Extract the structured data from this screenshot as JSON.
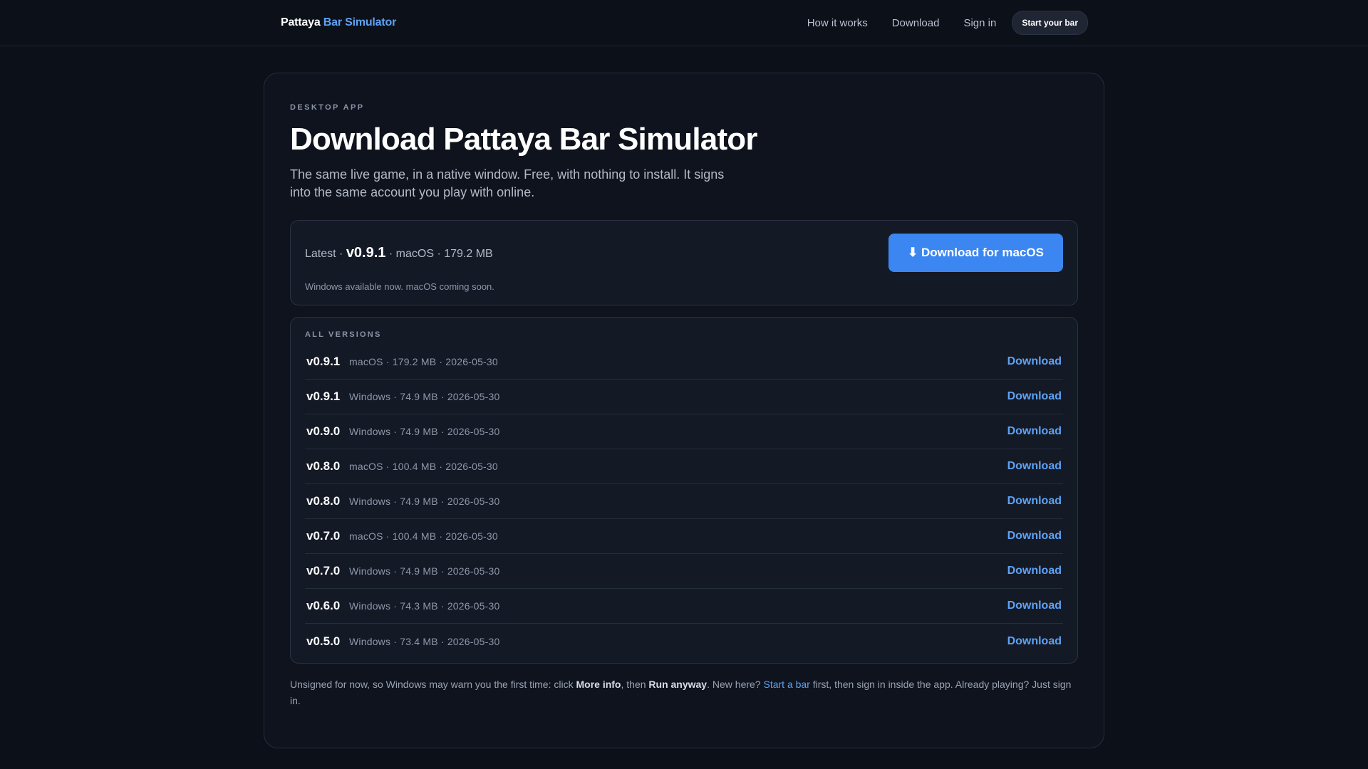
{
  "header": {
    "brand_part1": "Pattaya",
    "brand_part2": "Bar Simulator",
    "nav": {
      "how_it_works": "How it works",
      "download": "Download",
      "sign_in": "Sign in",
      "start_bar": "Start your bar"
    }
  },
  "hero": {
    "eyebrow": "DESKTOP APP",
    "title": "Download Pattaya Bar Simulator",
    "subtitle": "The same live game, in a native window. Free, with nothing to install. It signs into the same account you play with online."
  },
  "latest": {
    "prefix": "Latest ·",
    "version": "v0.9.1",
    "meta": "· macOS · 179.2 MB",
    "note": "Windows available now. macOS coming soon.",
    "button_label": "⬇ Download for macOS",
    "button_color": "#3b86f0"
  },
  "versions": {
    "heading": "ALL VERSIONS",
    "link_label": "Download",
    "rows": [
      {
        "version": "v0.9.1",
        "meta": "macOS · 179.2 MB · 2026-05-30"
      },
      {
        "version": "v0.9.1",
        "meta": "Windows · 74.9 MB · 2026-05-30"
      },
      {
        "version": "v0.9.0",
        "meta": "Windows · 74.9 MB · 2026-05-30"
      },
      {
        "version": "v0.8.0",
        "meta": "macOS · 100.4 MB · 2026-05-30"
      },
      {
        "version": "v0.8.0",
        "meta": "Windows · 74.9 MB · 2026-05-30"
      },
      {
        "version": "v0.7.0",
        "meta": "macOS · 100.4 MB · 2026-05-30"
      },
      {
        "version": "v0.7.0",
        "meta": "Windows · 74.9 MB · 2026-05-30"
      },
      {
        "version": "v0.6.0",
        "meta": "Windows · 74.3 MB · 2026-05-30"
      },
      {
        "version": "v0.5.0",
        "meta": "Windows · 73.4 MB · 2026-05-30"
      }
    ]
  },
  "footnote": {
    "t1": "Unsigned for now, so Windows may warn you the first time: click ",
    "b1": "More info",
    "t2": ", then ",
    "b2": "Run anyway",
    "t3": ". New here? ",
    "link": "Start a bar",
    "t4": " first, then sign in inside the app. Already playing? Just sign in."
  },
  "colors": {
    "background": "#0c1019",
    "accent": "#5ea2f4"
  }
}
